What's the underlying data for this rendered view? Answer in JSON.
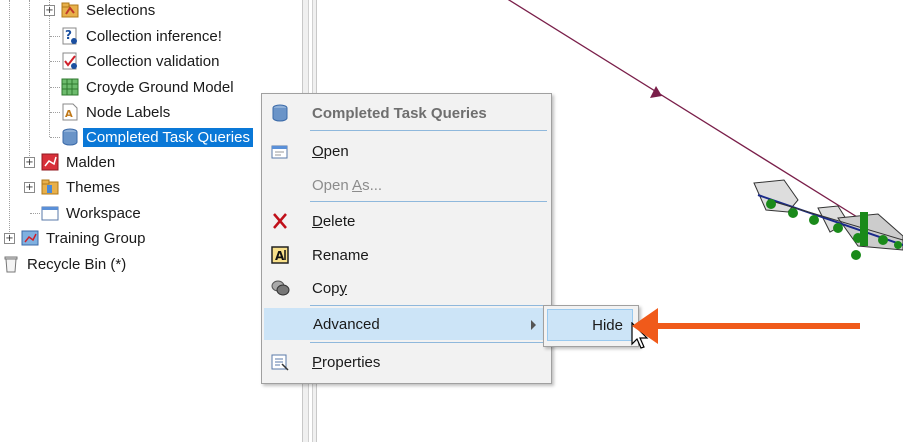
{
  "tree": {
    "items": [
      {
        "label": "Selections",
        "icon": "selections-folder-icon"
      },
      {
        "label": "Collection inference!",
        "icon": "inference-icon"
      },
      {
        "label": "Collection validation",
        "icon": "validation-icon"
      },
      {
        "label": "Croyde Ground Model",
        "icon": "ground-model-grid-icon"
      },
      {
        "label": "Node Labels",
        "icon": "label-document-icon"
      },
      {
        "label": "Completed Task Queries",
        "icon": "database-cylinder-icon"
      },
      {
        "label": "Malden",
        "icon": "network-icon"
      },
      {
        "label": "Themes",
        "icon": "themes-folder-icon"
      },
      {
        "label": "Workspace",
        "icon": "workspace-window-icon"
      },
      {
        "label": "Training Group",
        "icon": "group-icon"
      },
      {
        "label": "Recycle Bin (*)",
        "icon": "recycle-bin-icon"
      }
    ]
  },
  "context_menu": {
    "header": "Completed Task Queries",
    "items": [
      {
        "key": "open",
        "pre": "",
        "ul": "O",
        "post": "pen",
        "icon": "open-icon"
      },
      {
        "key": "open_as",
        "pre": "Open ",
        "ul": "A",
        "post": "s...",
        "icon": ""
      },
      {
        "key": "delete",
        "pre": "",
        "ul": "D",
        "post": "elete",
        "icon": "delete-x-icon"
      },
      {
        "key": "rename",
        "pre": "Rename",
        "ul": "",
        "post": "",
        "icon": "rename-icon"
      },
      {
        "key": "copy",
        "pre": "Cop",
        "ul": "y",
        "post": "",
        "icon": "copy-icon"
      },
      {
        "key": "advanced",
        "pre": "Advanced",
        "ul": "",
        "post": "",
        "icon": ""
      },
      {
        "key": "properties",
        "pre": "",
        "ul": "P",
        "post": "roperties",
        "icon": "properties-icon"
      }
    ]
  },
  "submenu": {
    "hide_label": "Hide"
  },
  "colors": {
    "selection": "#0a78d7",
    "menu_highlight": "#cce4f7",
    "annotation_arrow": "#f05a1a",
    "link_line": "#7a1f4a",
    "node_green": "#1a8a1a"
  }
}
